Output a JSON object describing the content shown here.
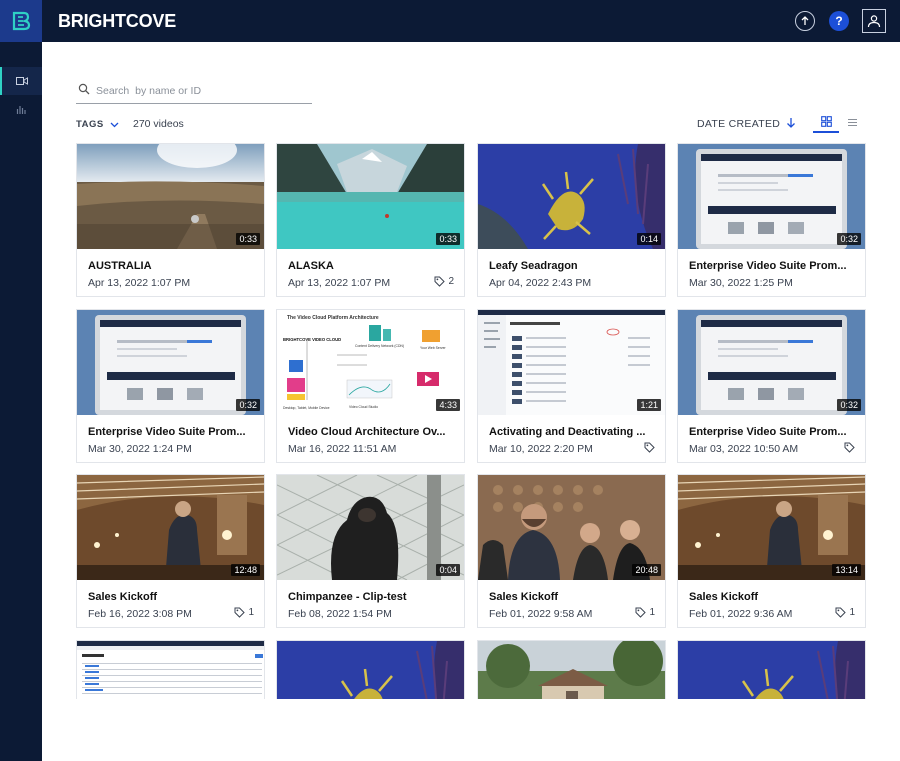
{
  "app": {
    "brand": "BRIGHTCOVE"
  },
  "topbar": {
    "help_label": "?"
  },
  "sidebar": {
    "items": [
      {
        "icon": "video-camera-icon",
        "active": true
      },
      {
        "icon": "analytics-bars-icon",
        "active": false
      }
    ]
  },
  "search": {
    "placeholder": "Search  by name or ID",
    "value": ""
  },
  "filters": {
    "tags_label": "TAGS",
    "count_label": "270 videos"
  },
  "sort": {
    "label": "DATE CREATED",
    "direction": "descending"
  },
  "videos": [
    {
      "title": "AUSTRALIA",
      "date": "Apr 13, 2022 1:07 PM",
      "duration": "0:33",
      "tags": null,
      "thumb": "outback"
    },
    {
      "title": "ALASKA",
      "date": "Apr 13, 2022 1:07 PM",
      "duration": "0:33",
      "tags": "2",
      "thumb": "lake"
    },
    {
      "title": "Leafy Seadragon",
      "date": "Apr 04, 2022 2:43 PM",
      "duration": "0:14",
      "tags": null,
      "thumb": "seadragon"
    },
    {
      "title": "Enterprise Video Suite Prom...",
      "date": "Mar 30, 2022 1:25 PM",
      "duration": "0:32",
      "tags": null,
      "thumb": "laptop"
    },
    {
      "title": "Enterprise Video Suite Prom...",
      "date": "Mar 30, 2022 1:24 PM",
      "duration": "0:32",
      "tags": null,
      "thumb": "laptop"
    },
    {
      "title": "Video Cloud Architecture Ov...",
      "date": "Mar 16, 2022 11:51 AM",
      "duration": "4:33",
      "tags": null,
      "thumb": "diagram"
    },
    {
      "title": "Activating and Deactivating ...",
      "date": "Mar 10, 2022 2:20 PM",
      "duration": "1:21",
      "tags": "",
      "thumb": "screen"
    },
    {
      "title": "Enterprise Video Suite Prom...",
      "date": "Mar 03, 2022 10:50 AM",
      "duration": "0:32",
      "tags": "",
      "thumb": "laptop"
    },
    {
      "title": "Sales Kickoff",
      "date": "Feb 16, 2022 3:08 PM",
      "duration": "12:48",
      "tags": "1",
      "thumb": "stage"
    },
    {
      "title": "Chimpanzee - Clip-test",
      "date": "Feb 08, 2022 1:54 PM",
      "duration": "0:04",
      "tags": null,
      "thumb": "chimp"
    },
    {
      "title": "Sales Kickoff",
      "date": "Feb 01, 2022 9:58 AM",
      "duration": "20:48",
      "tags": "1",
      "thumb": "audience"
    },
    {
      "title": "Sales Kickoff",
      "date": "Feb 01, 2022 9:36 AM",
      "duration": "13:14",
      "tags": "1",
      "thumb": "stage"
    },
    {
      "title": "",
      "date": "",
      "duration": "",
      "tags": null,
      "thumb": "players"
    },
    {
      "title": "",
      "date": "",
      "duration": "",
      "tags": null,
      "thumb": "seadragon"
    },
    {
      "title": "",
      "date": "",
      "duration": "",
      "tags": null,
      "thumb": "house"
    },
    {
      "title": "",
      "date": "",
      "duration": "",
      "tags": null,
      "thumb": "seadragon"
    }
  ],
  "diagram_thumb": {
    "heading": "The Video Cloud Platform Architecture",
    "logo": "BRIGHTCOVE VIDEO CLOUD",
    "cdn": "Content Delivery Network (CDN)",
    "web": "Your Web Server",
    "devices": "Desktop, Tablet, Mobile Device",
    "studio": "Video Cloud Studio"
  },
  "colors": {
    "nav_bg": "#0c1a35",
    "accent_blue": "#1c4fd8",
    "active_teal": "#2fd2c5"
  }
}
